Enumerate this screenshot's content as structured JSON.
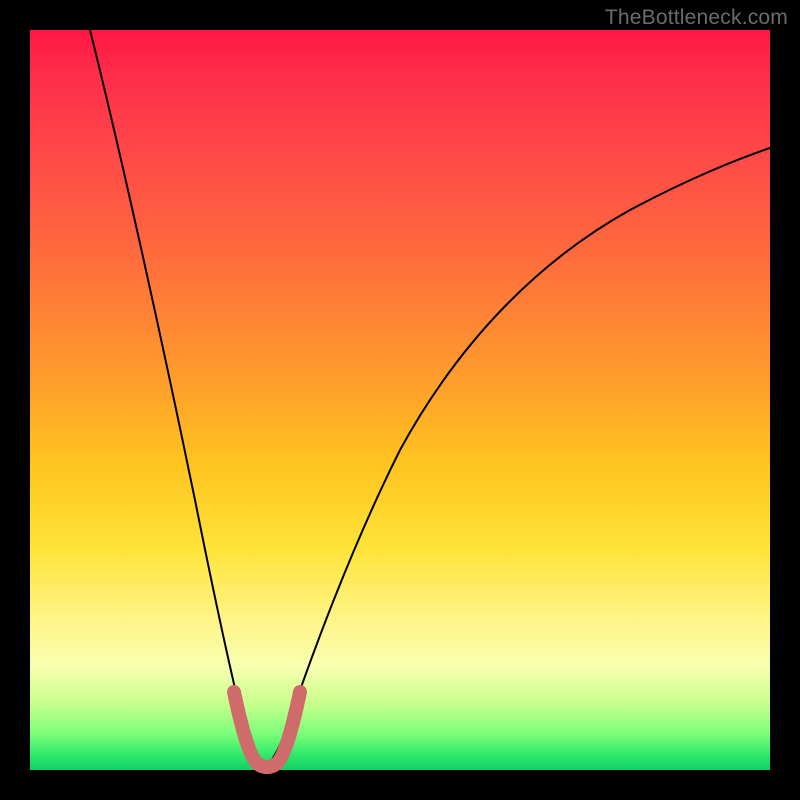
{
  "watermark": "TheBottleneck.com",
  "chart_data": {
    "type": "line",
    "title": "",
    "xlabel": "",
    "ylabel": "",
    "xlim": [
      0,
      100
    ],
    "ylim": [
      0,
      100
    ],
    "series": [
      {
        "name": "bottleneck-curve",
        "color": "#000000",
        "x": [
          0,
          5,
          10,
          15,
          18,
          22,
          25,
          27,
          29,
          30,
          31,
          32,
          34,
          38,
          45,
          55,
          65,
          75,
          85,
          95,
          100
        ],
        "values": [
          100,
          90,
          77,
          60,
          48,
          33,
          19,
          10,
          3,
          1,
          1,
          3,
          10,
          23,
          40,
          55,
          65,
          72,
          77,
          80,
          81
        ]
      },
      {
        "name": "highlight-minimum",
        "color": "#d06b6b",
        "x": [
          25,
          27,
          29,
          30,
          31,
          32,
          34
        ],
        "values": [
          18,
          10,
          3,
          1,
          1,
          3,
          10
        ]
      }
    ],
    "annotations": []
  }
}
